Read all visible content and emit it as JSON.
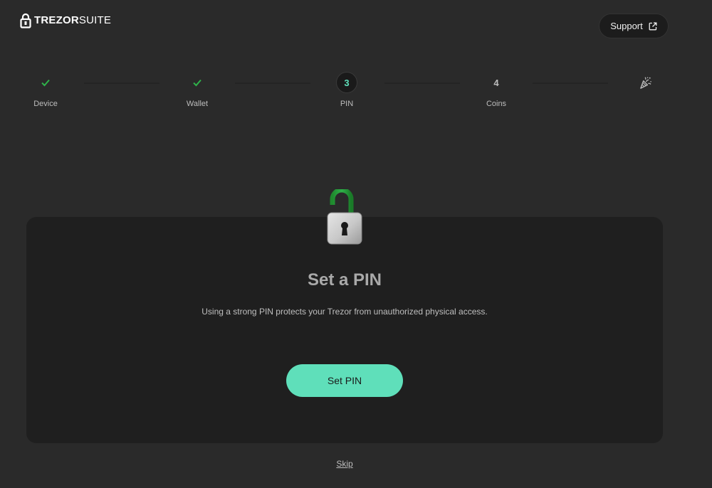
{
  "header": {
    "logo_strong": "TREZOR",
    "logo_light": "SUITE",
    "support_label": "Support"
  },
  "stepper": {
    "steps": [
      {
        "label": "Device",
        "state": "done",
        "marker": ""
      },
      {
        "label": "Wallet",
        "state": "done",
        "marker": ""
      },
      {
        "label": "PIN",
        "state": "active",
        "marker": "3"
      },
      {
        "label": "Coins",
        "state": "pending",
        "marker": "4"
      },
      {
        "label": "",
        "state": "final",
        "marker": ""
      }
    ]
  },
  "card": {
    "title": "Set a PIN",
    "description": "Using a strong PIN protects your Trezor from unauthorized physical access.",
    "button_label": "Set PIN"
  },
  "footer": {
    "skip_label": "Skip"
  },
  "colors": {
    "accent": "#5fdfba",
    "check_green": "#2fb24a",
    "background": "#2a2a2a",
    "card": "#1f1f1f"
  },
  "icons": {
    "logo": "trezor-lock-icon",
    "support": "external-link-icon",
    "done_step": "checkmark-icon",
    "final_step": "party-popper-icon",
    "hero": "open-padlock-icon"
  }
}
